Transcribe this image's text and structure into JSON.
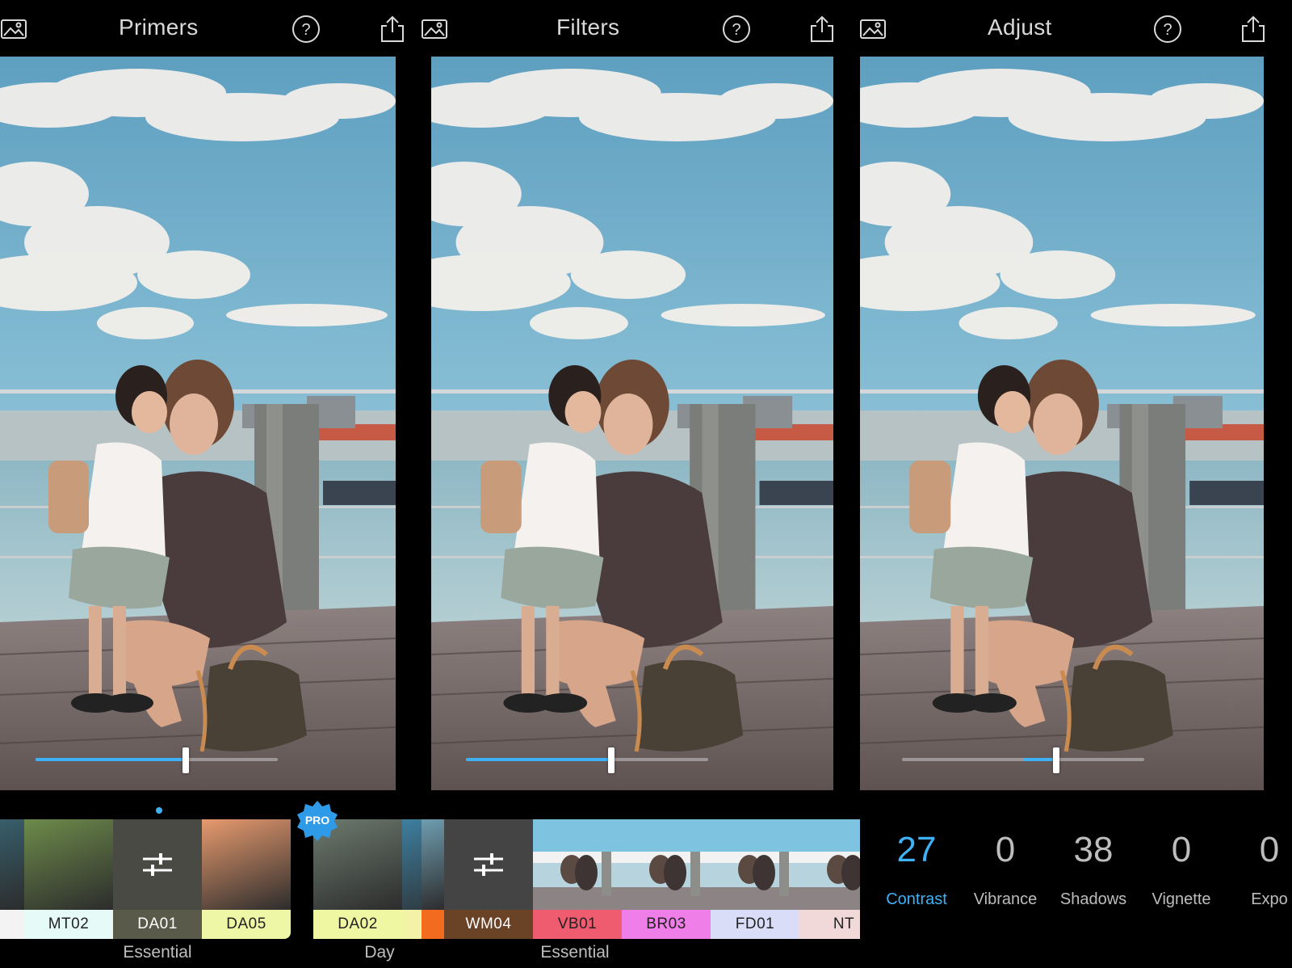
{
  "colors": {
    "accent": "#3fb1f5",
    "background": "#000000",
    "label_gray": "#bdbdbd"
  },
  "icons": {
    "gallery": "image-gallery-icon",
    "help": "question-circle-icon",
    "share": "share-upload-icon",
    "adjust": "sliders-icon"
  },
  "primers": {
    "title": "Primers",
    "strength": 0.62,
    "tiles": [
      {
        "code": "",
        "bg": "#f3f3f3",
        "thumb": "#3a6a7a"
      },
      {
        "code": "MT02",
        "bg": "#e6faf8",
        "thumb": "#6d8b4a"
      },
      {
        "code": "DA01",
        "bg": "#5a5a4a",
        "thumb": "#4a4a44",
        "adjust": true
      },
      {
        "code": "DA05",
        "bg": "#eef7a6",
        "thumb": "#e79a6e"
      },
      {
        "code": "DA02",
        "bg": "#f0f7a2",
        "thumb": "#6c7a6e"
      },
      {
        "code": "",
        "bg": "#f3f3a8",
        "thumb": "#3d7fa0"
      }
    ],
    "groups": [
      "Essential",
      "Day"
    ],
    "pro_label": "PRO"
  },
  "filters": {
    "title": "Filters",
    "strength": 0.6,
    "tiles": [
      {
        "code": "",
        "bg": "#f26b1f",
        "thumb": "#7fb9d1"
      },
      {
        "code": "WM04",
        "bg": "#6a4226",
        "thumb": "#444",
        "adjust": true
      },
      {
        "code": "VB01",
        "bg": "#ef5b6f",
        "thumb": "#6fb8d8"
      },
      {
        "code": "BR03",
        "bg": "#f07ee8",
        "thumb": "#8ec8e0"
      },
      {
        "code": "FD01",
        "bg": "#d9ddf8",
        "thumb": "#8ab8c8"
      },
      {
        "code": "NT",
        "bg": "#f2d9d9",
        "thumb": "#8cbccf"
      }
    ],
    "group": "Essential"
  },
  "adjust": {
    "title": "Adjust",
    "contrast_level": 0.27,
    "items": [
      {
        "value": "27",
        "label": "Contrast",
        "active": true
      },
      {
        "value": "0",
        "label": "Vibrance",
        "active": false
      },
      {
        "value": "38",
        "label": "Shadows",
        "active": false
      },
      {
        "value": "0",
        "label": "Vignette",
        "active": false
      },
      {
        "value": "0",
        "label": "Expo",
        "active": false
      }
    ]
  }
}
